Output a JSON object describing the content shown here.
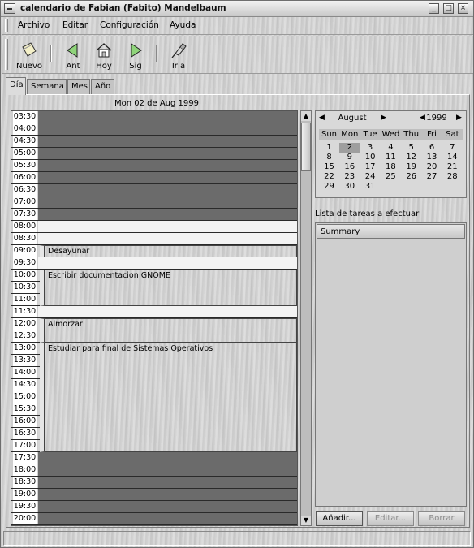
{
  "window": {
    "title": "calendario de Fabian (Fabito) Mandelbaum"
  },
  "menubar": {
    "items": [
      "Archivo",
      "Editar",
      "Configuración",
      "Ayuda"
    ]
  },
  "toolbar": {
    "buttons": [
      {
        "label": "Nuevo",
        "icon": "new-note-icon"
      },
      {
        "label": "Ant",
        "icon": "back-arrow-icon"
      },
      {
        "label": "Hoy",
        "icon": "home-icon"
      },
      {
        "label": "Sig",
        "icon": "forward-arrow-icon"
      },
      {
        "label": "Ir a",
        "icon": "goto-pin-icon"
      }
    ]
  },
  "tabs": [
    "Día",
    "Semana",
    "Mes",
    "Año"
  ],
  "active_tab": "Día",
  "day_view": {
    "date": "Mon 02 de Aug 1999",
    "times": [
      "03:30",
      "04:00",
      "04:30",
      "05:00",
      "05:30",
      "06:00",
      "06:30",
      "07:00",
      "07:30",
      "08:00",
      "08:30",
      "09:00",
      "09:30",
      "10:00",
      "10:30",
      "11:00",
      "11:30",
      "12:00",
      "12:30",
      "13:00",
      "13:30",
      "14:00",
      "14:30",
      "15:00",
      "15:30",
      "16:00",
      "16:30",
      "17:00",
      "17:30",
      "18:00",
      "18:30",
      "19:00",
      "19:30",
      "20:00"
    ],
    "events": [
      {
        "title": "Desayunar",
        "start": "09:00",
        "end": "09:30"
      },
      {
        "title": "Escribir documentacion GNOME",
        "start": "10:00",
        "end": "11:30"
      },
      {
        "title": "Almorzar",
        "start": "12:00",
        "end": "13:00"
      },
      {
        "title": "Estudiar para final de Sistemas Operativos",
        "start": "13:00",
        "end": "17:30"
      }
    ],
    "work_start": "08:00",
    "work_end": "17:30"
  },
  "mini_calendar": {
    "month": "August",
    "year": "1999",
    "weekdays": [
      "Sun",
      "Mon",
      "Tue",
      "Wed",
      "Thu",
      "Fri",
      "Sat"
    ],
    "weeks": [
      [
        "1",
        "2",
        "3",
        "4",
        "5",
        "6",
        "7"
      ],
      [
        "8",
        "9",
        "10",
        "11",
        "12",
        "13",
        "14"
      ],
      [
        "15",
        "16",
        "17",
        "18",
        "19",
        "20",
        "21"
      ],
      [
        "22",
        "23",
        "24",
        "25",
        "26",
        "27",
        "28"
      ],
      [
        "29",
        "30",
        "31",
        "",
        "",
        "",
        ""
      ]
    ],
    "selected": "2"
  },
  "todo": {
    "label": "Lista de tareas a efectuar",
    "column": "Summary",
    "buttons": {
      "add": "Añadir...",
      "edit": "Editar...",
      "delete": "Borrar"
    }
  },
  "colors": {
    "off_hours": "#6b6b6b",
    "work_hours": "#f3f3f3",
    "selected_day": "#9e9e9e"
  }
}
